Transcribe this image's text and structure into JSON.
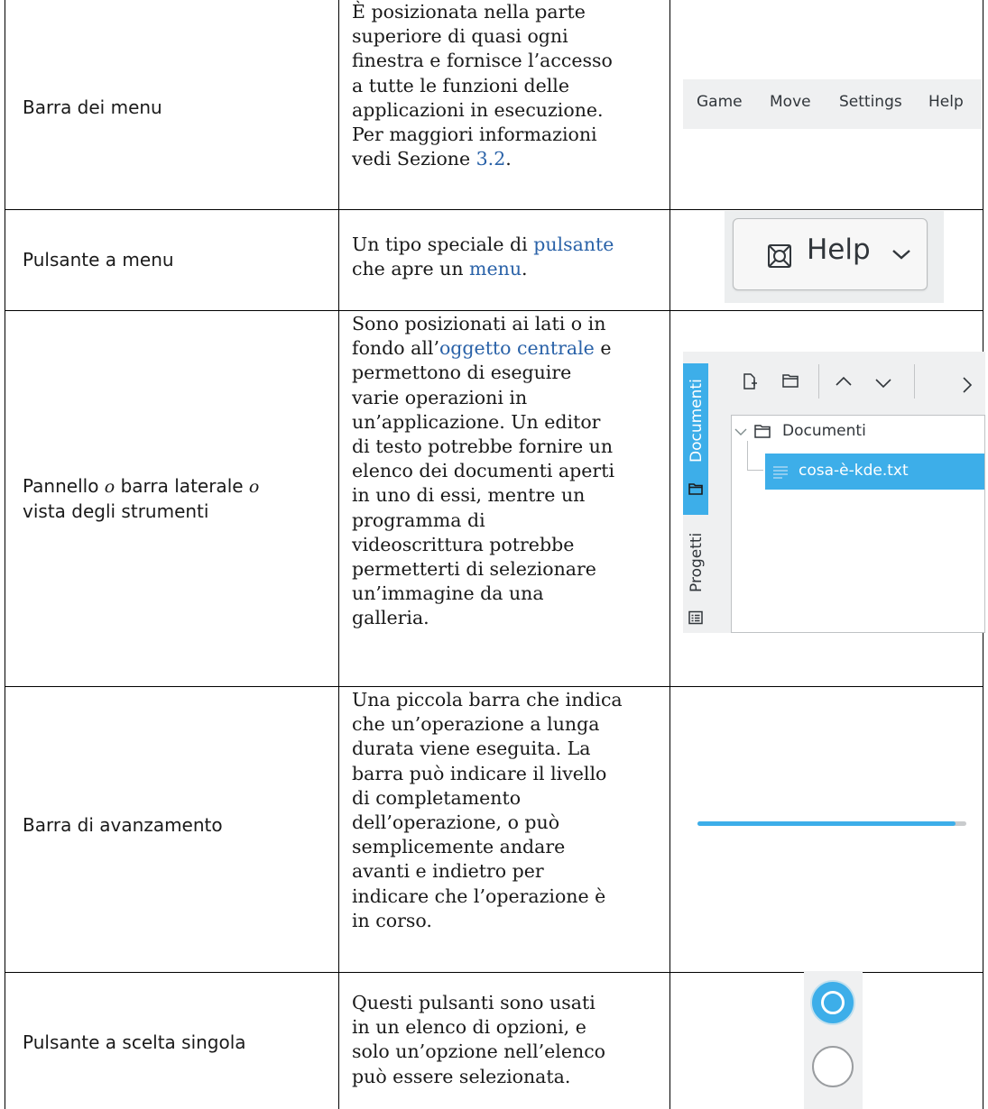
{
  "rows": [
    {
      "term": "Barra dei menu",
      "desc_lines": [
        "È posizionata nella parte",
        "superiore di quasi ogni",
        "finestra e fornisce l’accesso",
        "a tutte le funzioni delle",
        "applicazioni in esecuzione.",
        "Per maggiori informazioni"
      ],
      "desc_last_prefix": "vedi Sezione ",
      "desc_last_link": "3.2",
      "desc_last_suffix": ".",
      "menu_items": [
        "Game",
        "Move",
        "Settings",
        "Help"
      ]
    },
    {
      "term": "Pulsante a menu",
      "desc_l1_prefix": "Un tipo speciale di ",
      "desc_l1_link": "pulsante",
      "desc_l2_prefix": "che apre un ",
      "desc_l2_link": "menu",
      "desc_l2_suffix": ".",
      "button_label": "Help",
      "button_icon": "help-lifebuoy-icon",
      "button_arrow": "chevron-down-icon"
    },
    {
      "term_a": "Pannello ",
      "term_o1": "o",
      "term_b": " barra laterale ",
      "term_o2": "o",
      "term_c": "vista degli strumenti",
      "desc_l1": "Sono posizionati ai lati o in",
      "desc_l2_prefix": "fondo all’",
      "desc_l2_link": "oggetto centrale",
      "desc_l2_suffix": " e",
      "desc_lines": [
        "permettono di eseguire",
        "varie operazioni in",
        "un’applicazione. Un editor",
        "di testo potrebbe fornire un",
        "elenco dei documenti aperti",
        "in uno di essi, mentre un",
        "programma di",
        "videoscrittura potrebbe",
        "permetterti di selezionare",
        "un’immagine da una",
        "galleria."
      ],
      "tabs": [
        "Documenti",
        "Progetti"
      ],
      "tree_folder": "Documenti",
      "tree_file": "cosa-è-kde.txt"
    },
    {
      "term": "Barra di avanzamento",
      "desc_lines": [
        "Una piccola barra che indica",
        "che un’operazione a lunga",
        "durata viene eseguita. La",
        "barra può indicare il livello",
        "di completamento",
        "dell’operazione, o può",
        "semplicemente andare",
        "avanti e indietro per",
        "indicare che l’operazione è",
        "in corso."
      ],
      "progress_fraction": 0.96
    },
    {
      "term": "Pulsante a scelta singola",
      "desc_lines": [
        "Questi pulsanti sono usati",
        "in un elenco di opzioni, e",
        "solo un’opzione nell’elenco",
        "può essere selezionata."
      ]
    }
  ],
  "colors": {
    "accent": "#3daee9",
    "link": "#2a62a8",
    "widget_bg": "#eff0f1"
  }
}
